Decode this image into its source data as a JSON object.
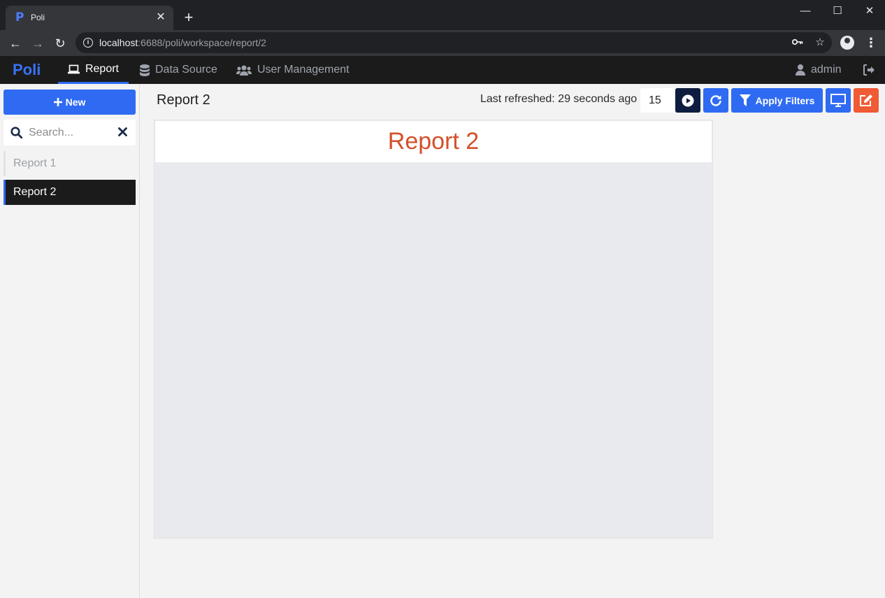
{
  "browser": {
    "tab_title": "Poli",
    "favicon_letter": "P",
    "tab_close": "✕",
    "new_tab": "+",
    "url_host": "localhost",
    "url_rest": ":6688/poli/workspace/report/2",
    "window_controls": {
      "minimize": "—",
      "maximize": "☐",
      "close": "✕"
    },
    "nav": {
      "back": "←",
      "forward": "→",
      "reload": "↻"
    },
    "icons": [
      "key-icon",
      "star-icon",
      "profile-icon",
      "menu-icon"
    ]
  },
  "appnav": {
    "brand": "Poli",
    "items": [
      {
        "label": "Report",
        "icon": "laptop-icon",
        "active": true
      },
      {
        "label": "Data Source",
        "icon": "database-icon",
        "active": false
      },
      {
        "label": "User Management",
        "icon": "users-icon",
        "active": false
      }
    ],
    "user": "admin"
  },
  "sidebar": {
    "new_label": "New",
    "search_placeholder": "Search...",
    "reports": [
      {
        "label": "Report 1",
        "active": false
      },
      {
        "label": "Report 2",
        "active": true
      }
    ]
  },
  "main": {
    "title": "Report 2",
    "last_refreshed": "Last refreshed: 29 seconds ago",
    "interval": "15",
    "apply_filters_label": "Apply Filters",
    "report_heading": "Report 2"
  },
  "colors": {
    "accent": "#2f6bf2",
    "dark": "#1b1b1b",
    "play_button": "#0e1d3f",
    "edit_button": "#f05a35",
    "report_heading": "#d4502a"
  }
}
